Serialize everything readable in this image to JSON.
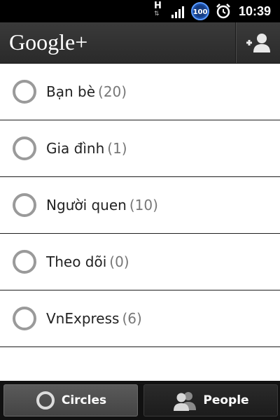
{
  "status_bar": {
    "network_letter": "H",
    "network_arrows": "⇅",
    "battery_level": "100",
    "time": "10:39",
    "icons": [
      "network-h-icon",
      "signal-icon",
      "battery-icon",
      "alarm-icon"
    ]
  },
  "app_bar": {
    "title": "Google+",
    "action_icon": "add-person-icon"
  },
  "circles": [
    {
      "name": "Bạn bè",
      "count": "(20)"
    },
    {
      "name": "Gia đình",
      "count": "(1)"
    },
    {
      "name": "Người quen",
      "count": "(10)"
    },
    {
      "name": "Theo dõi",
      "count": "(0)"
    },
    {
      "name": "VnExpress",
      "count": "(6)"
    }
  ],
  "tabs": [
    {
      "label": "Circles",
      "icon": "circle-icon",
      "selected": true
    },
    {
      "label": "People",
      "icon": "people-icon",
      "selected": false
    }
  ],
  "colors": {
    "app_bar": "#333333",
    "tab_selected": "#4f4f4f",
    "ring": "#9a9a9a"
  }
}
